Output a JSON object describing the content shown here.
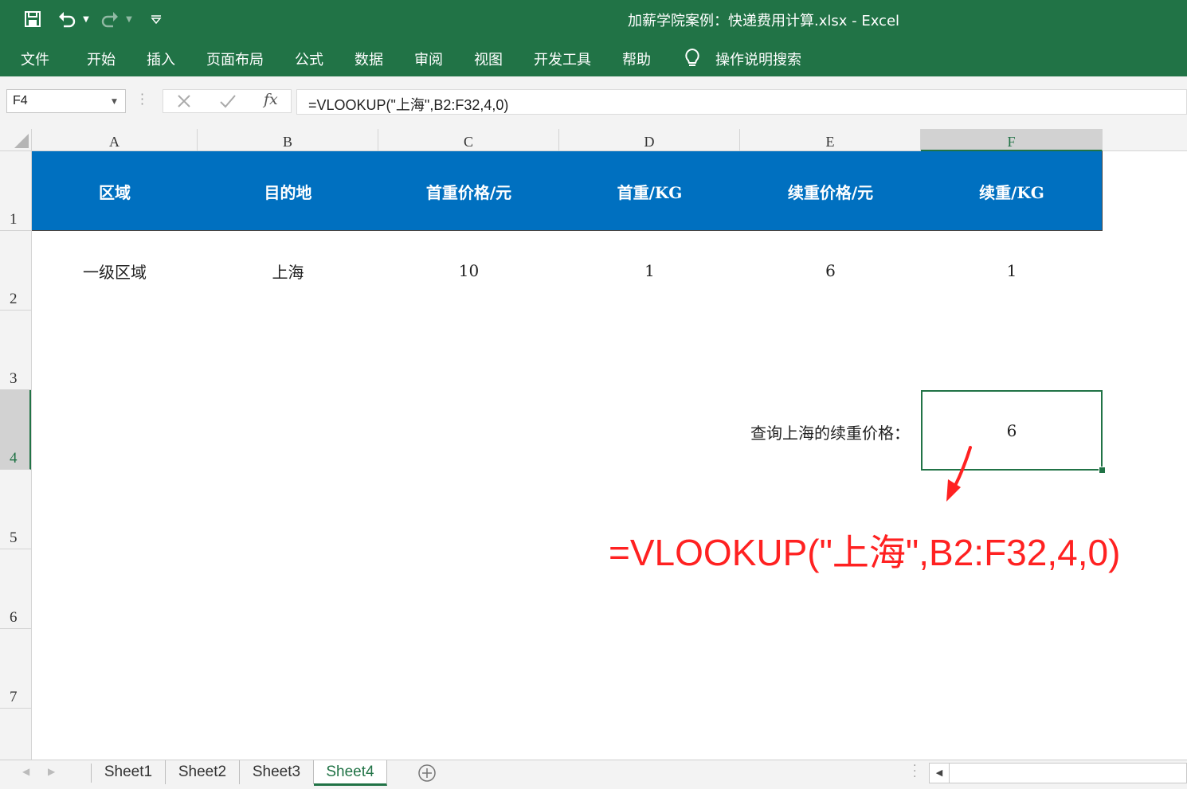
{
  "window": {
    "title": "加薪学院案例：快递费用计算.xlsx  -  Excel"
  },
  "quick_access": {
    "save_icon": "save-icon",
    "undo_icon": "undo-icon",
    "redo_icon": "redo-icon",
    "customize_icon": "customize-icon"
  },
  "ribbon": {
    "tabs": [
      "文件",
      "开始",
      "插入",
      "页面布局",
      "公式",
      "数据",
      "审阅",
      "视图",
      "开发工具",
      "帮助"
    ],
    "tell_me": "操作说明搜索"
  },
  "formula_bar": {
    "name_box": "F4",
    "fx_label": "fx",
    "formula": "=VLOOKUP(\"上海\",B2:F32,4,0)"
  },
  "sheet": {
    "columns": [
      "A",
      "B",
      "C",
      "D",
      "E",
      "F"
    ],
    "selected_column": "F",
    "rows": [
      "1",
      "2",
      "3",
      "4",
      "5",
      "6",
      "7"
    ],
    "selected_row": "4",
    "headers": [
      "区域",
      "目的地",
      "首重价格/元",
      "首重/KG",
      "续重价格/元",
      "续重/KG"
    ],
    "row2": [
      "一级区域",
      "上海",
      "10",
      "1",
      "6",
      "1"
    ],
    "lookup_label": "查询上海的续重价格：",
    "lookup_value": "6"
  },
  "annotation": {
    "formula": "=VLOOKUP(\"上海\",B2:F32,4,0)",
    "color": "#ff2121"
  },
  "sheet_tabs": {
    "tabs": [
      "Sheet1",
      "Sheet2",
      "Sheet3",
      "Sheet4"
    ],
    "active": "Sheet4"
  },
  "colors": {
    "excel_green": "#217346",
    "header_blue": "#0070c0"
  }
}
